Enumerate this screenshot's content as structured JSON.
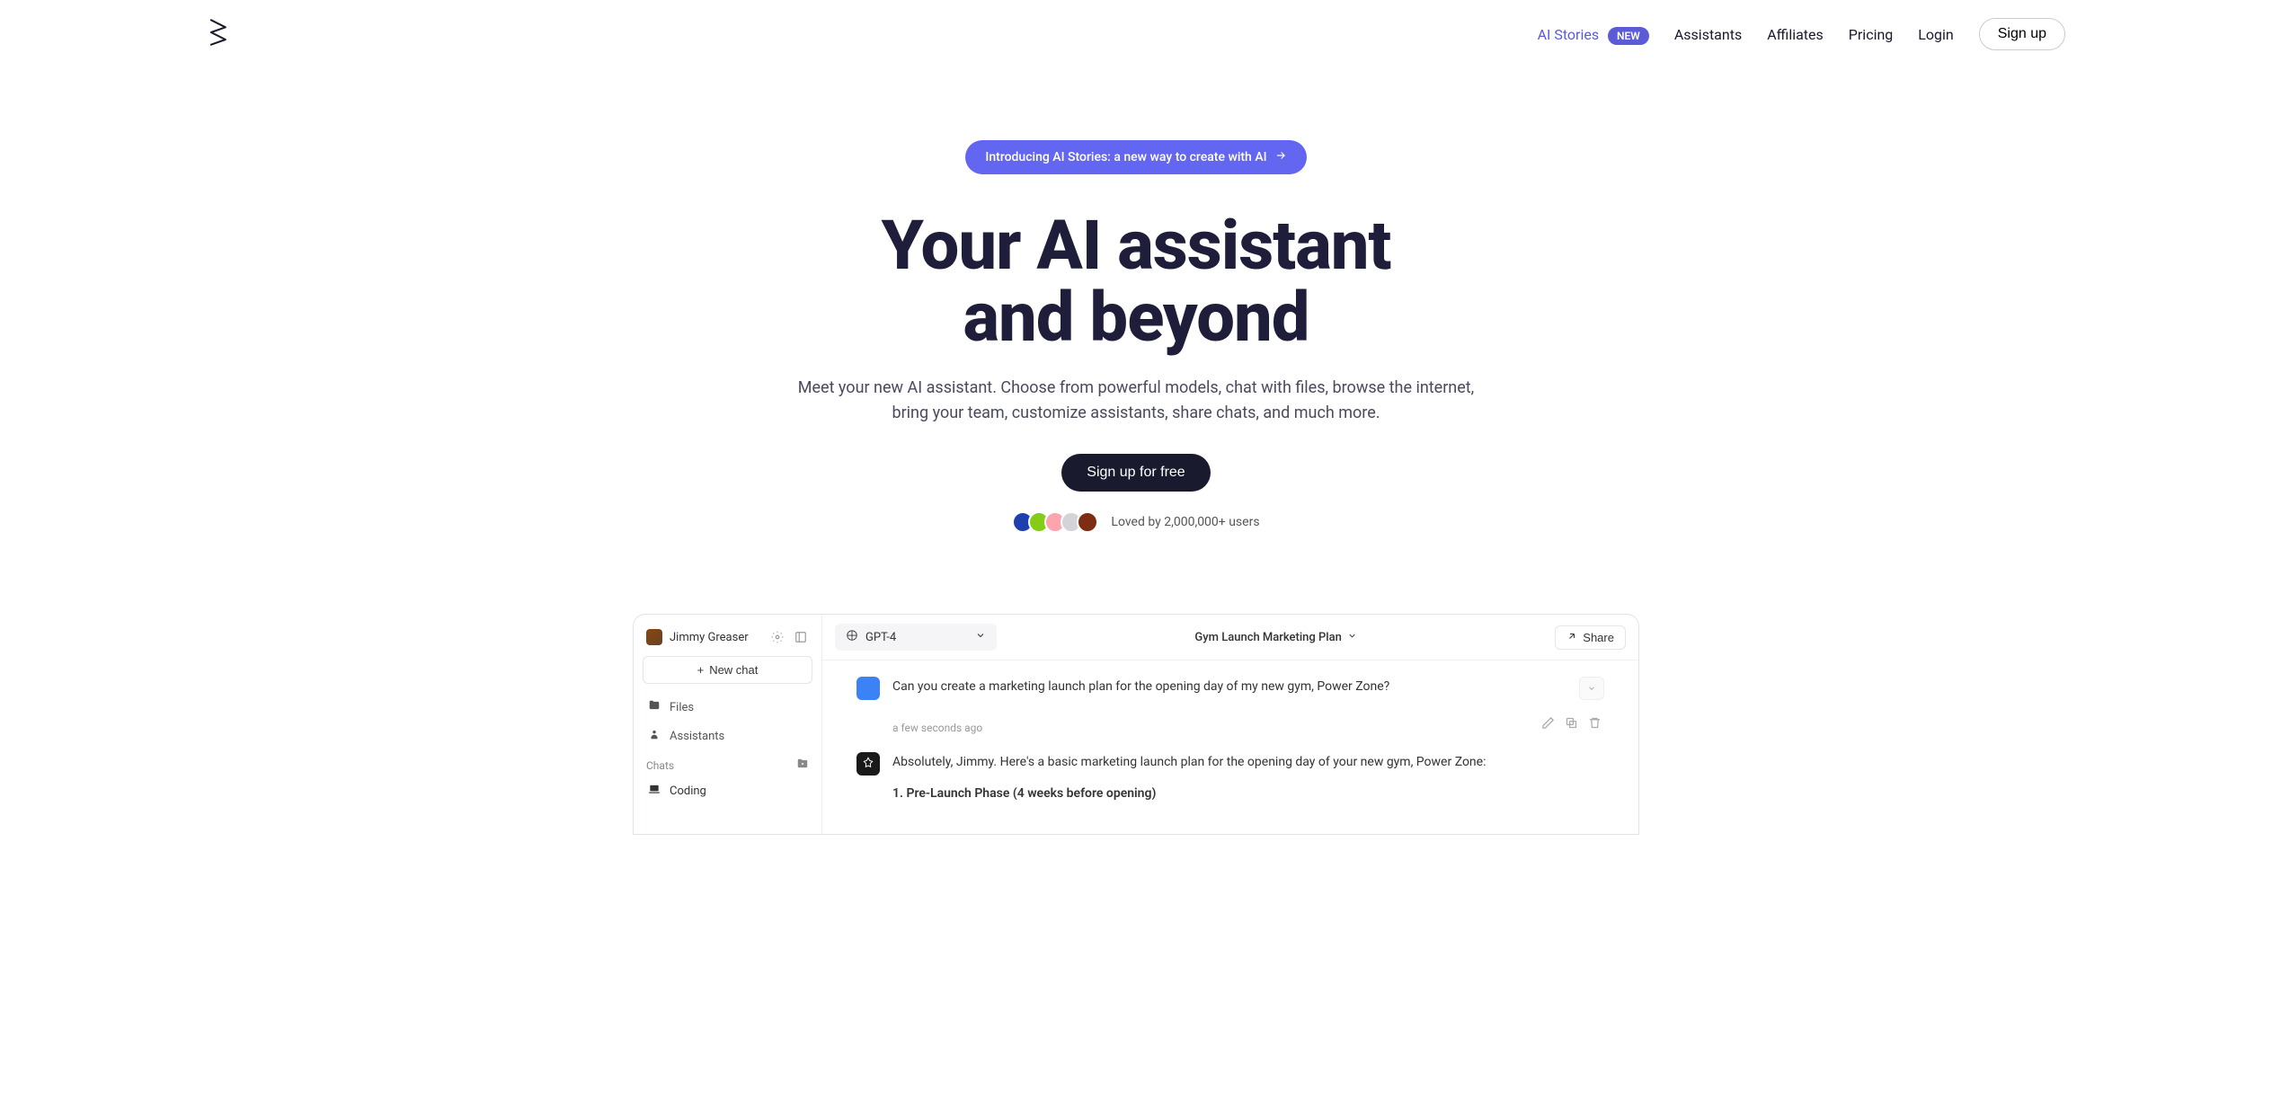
{
  "nav": {
    "ai_stories": "AI Stories",
    "new_badge": "NEW",
    "assistants": "Assistants",
    "affiliates": "Affiliates",
    "pricing": "Pricing",
    "login": "Login",
    "signup": "Sign up"
  },
  "hero": {
    "announce": "Introducing AI Stories: a new way to create with AI",
    "title_l1": "Your AI assistant",
    "title_l2": "and beyond",
    "subtitle": "Meet your new AI assistant. Choose from powerful models, chat with files, browse the internet, bring your team, customize assistants, share chats, and much more.",
    "cta": "Sign up for free",
    "social": "Loved by 2,000,000+ users"
  },
  "avatar_colors": [
    "#1e40af",
    "#84cc16",
    "#fda4af",
    "#d4d4d8",
    "#7c2d12"
  ],
  "mockup": {
    "user_name": "Jimmy Greaser",
    "new_chat": "New chat",
    "files": "Files",
    "assistants": "Assistants",
    "chats_section": "Chats",
    "chat_coding": "Coding",
    "model": "GPT-4",
    "chat_title": "Gym Launch Marketing Plan",
    "share": "Share",
    "msg_user": "Can you create a marketing launch plan for the opening day of my new gym, Power Zone?",
    "msg_time": "a few seconds ago",
    "msg_ai_intro": "Absolutely, Jimmy. Here's a basic marketing launch plan for the opening day of your new gym, Power Zone:",
    "msg_ai_h1": "1. Pre-Launch Phase (4 weeks before opening)"
  }
}
